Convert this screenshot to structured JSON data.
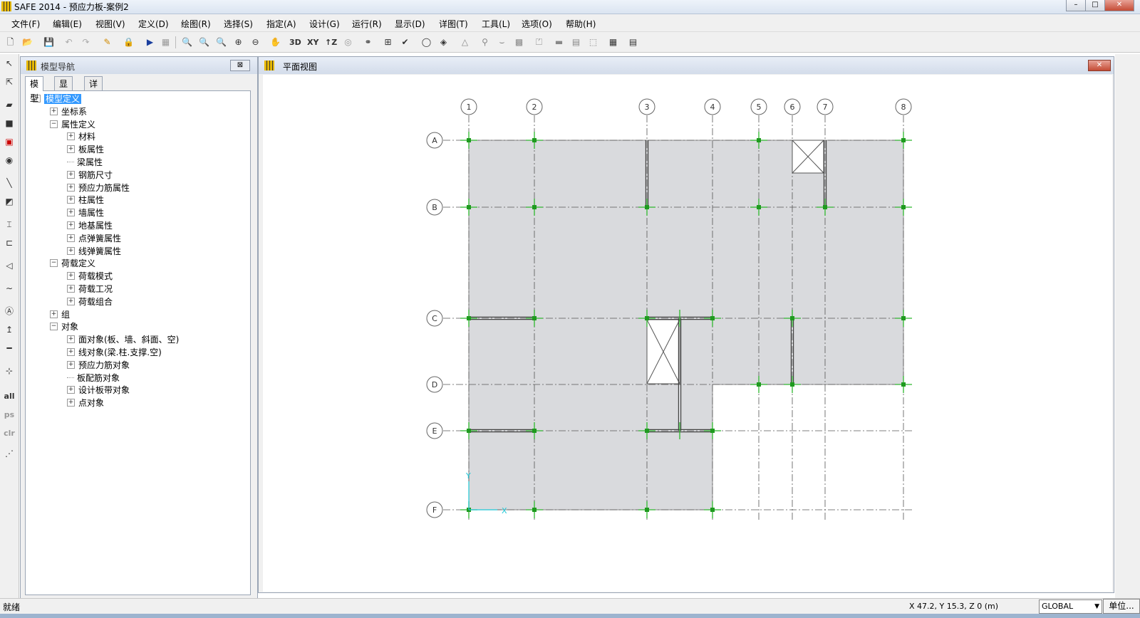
{
  "window": {
    "title": "SAFE 2014 - 预应力板-案例2"
  },
  "menu": [
    "文件(F)",
    "编辑(E)",
    "视图(V)",
    "定义(D)",
    "绘图(R)",
    "选择(S)",
    "指定(A)",
    "设计(G)",
    "运行(R)",
    "显示(D)",
    "详图(T)",
    "工具(L)",
    "选项(O)",
    "帮助(H)"
  ],
  "toolbar": {
    "btn_3d": "3D",
    "btn_xy": "XY",
    "btn_xz": "↑Z"
  },
  "lefttools": {
    "all": "all",
    "ps": "ps",
    "clr": "clr"
  },
  "nav": {
    "title": "模型导航",
    "close": "⊠",
    "tabs": [
      "模型",
      "显示",
      "详图"
    ],
    "tree": [
      {
        "label": "模型定义",
        "level": 0,
        "pm": "⊟",
        "selected": true
      },
      {
        "label": "坐标系",
        "level": 1,
        "pm": "⊞"
      },
      {
        "label": "属性定义",
        "level": 1,
        "pm": "⊟"
      },
      {
        "label": "材料",
        "level": 2,
        "pm": "⊞"
      },
      {
        "label": "板属性",
        "level": 2,
        "pm": "⊞"
      },
      {
        "label": "梁属性",
        "level": 2,
        "pm": ""
      },
      {
        "label": "钢筋尺寸",
        "level": 2,
        "pm": "⊞"
      },
      {
        "label": "预应力筋属性",
        "level": 2,
        "pm": "⊞"
      },
      {
        "label": "柱属性",
        "level": 2,
        "pm": "⊞"
      },
      {
        "label": "墙属性",
        "level": 2,
        "pm": "⊞"
      },
      {
        "label": "地基属性",
        "level": 2,
        "pm": "⊞"
      },
      {
        "label": "点弹簧属性",
        "level": 2,
        "pm": "⊞"
      },
      {
        "label": "线弹簧属性",
        "level": 2,
        "pm": "⊞"
      },
      {
        "label": "荷载定义",
        "level": 1,
        "pm": "⊟"
      },
      {
        "label": "荷载模式",
        "level": 2,
        "pm": "⊞"
      },
      {
        "label": "荷载工况",
        "level": 2,
        "pm": "⊞"
      },
      {
        "label": "荷载组合",
        "level": 2,
        "pm": "⊞"
      },
      {
        "label": "组",
        "level": 1,
        "pm": "⊞"
      },
      {
        "label": "对象",
        "level": 1,
        "pm": "⊟"
      },
      {
        "label": "面对象(板、墙、斜面、空)",
        "level": 2,
        "pm": "⊞"
      },
      {
        "label": "线对象(梁.柱.支撑.空)",
        "level": 2,
        "pm": "⊞"
      },
      {
        "label": "预应力筋对象",
        "level": 2,
        "pm": "⊞"
      },
      {
        "label": "板配筋对象",
        "level": 2,
        "pm": ""
      },
      {
        "label": "设计板带对象",
        "level": 2,
        "pm": "⊞"
      },
      {
        "label": "点对象",
        "level": 2,
        "pm": "⊞"
      }
    ]
  },
  "plan": {
    "title": "平面视图",
    "close": "✕",
    "grid_x": [
      "1",
      "2",
      "3",
      "4",
      "5",
      "6",
      "7",
      "8"
    ],
    "grid_y": [
      "A",
      "B",
      "C",
      "D",
      "E",
      "F"
    ],
    "axis_x": "X",
    "axis_y": "Y"
  },
  "status": {
    "text": "就绪",
    "coords": "X 47.2,  Y 15.3,  Z 0  (m)",
    "coordsys": "GLOBAL",
    "units_button": "单位..."
  },
  "colors": {
    "slab": "#d9dadd",
    "grid": "#555555",
    "node": "#2eb82e",
    "accent": "#3399ff"
  }
}
